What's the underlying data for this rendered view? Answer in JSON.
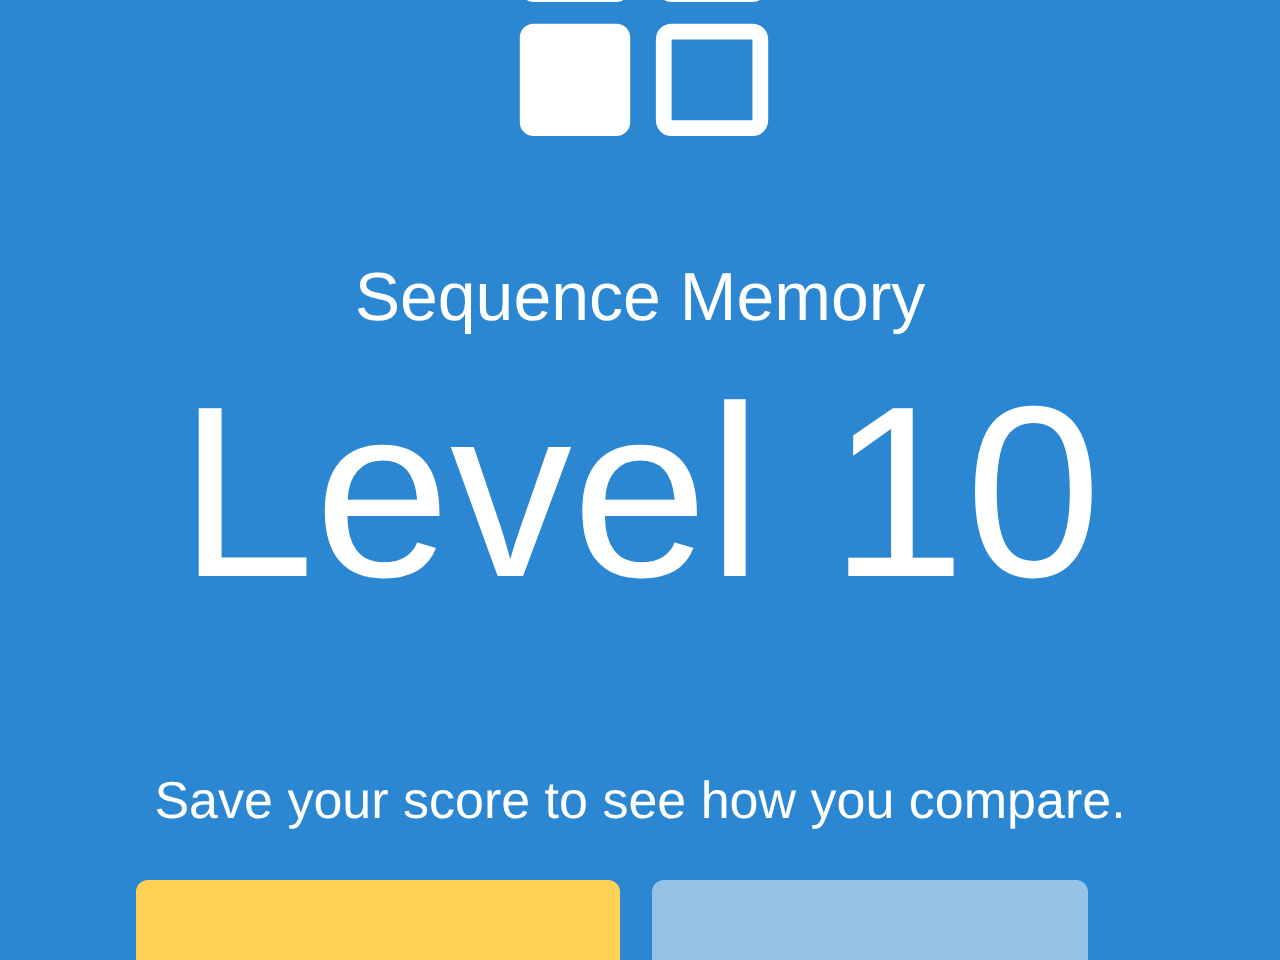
{
  "title": "Sequence Memory",
  "level": "Level 10",
  "message": "Save your score to see how you compare.",
  "buttons": [
    {
      "kind": "primary"
    },
    {
      "kind": "secondary"
    }
  ]
}
